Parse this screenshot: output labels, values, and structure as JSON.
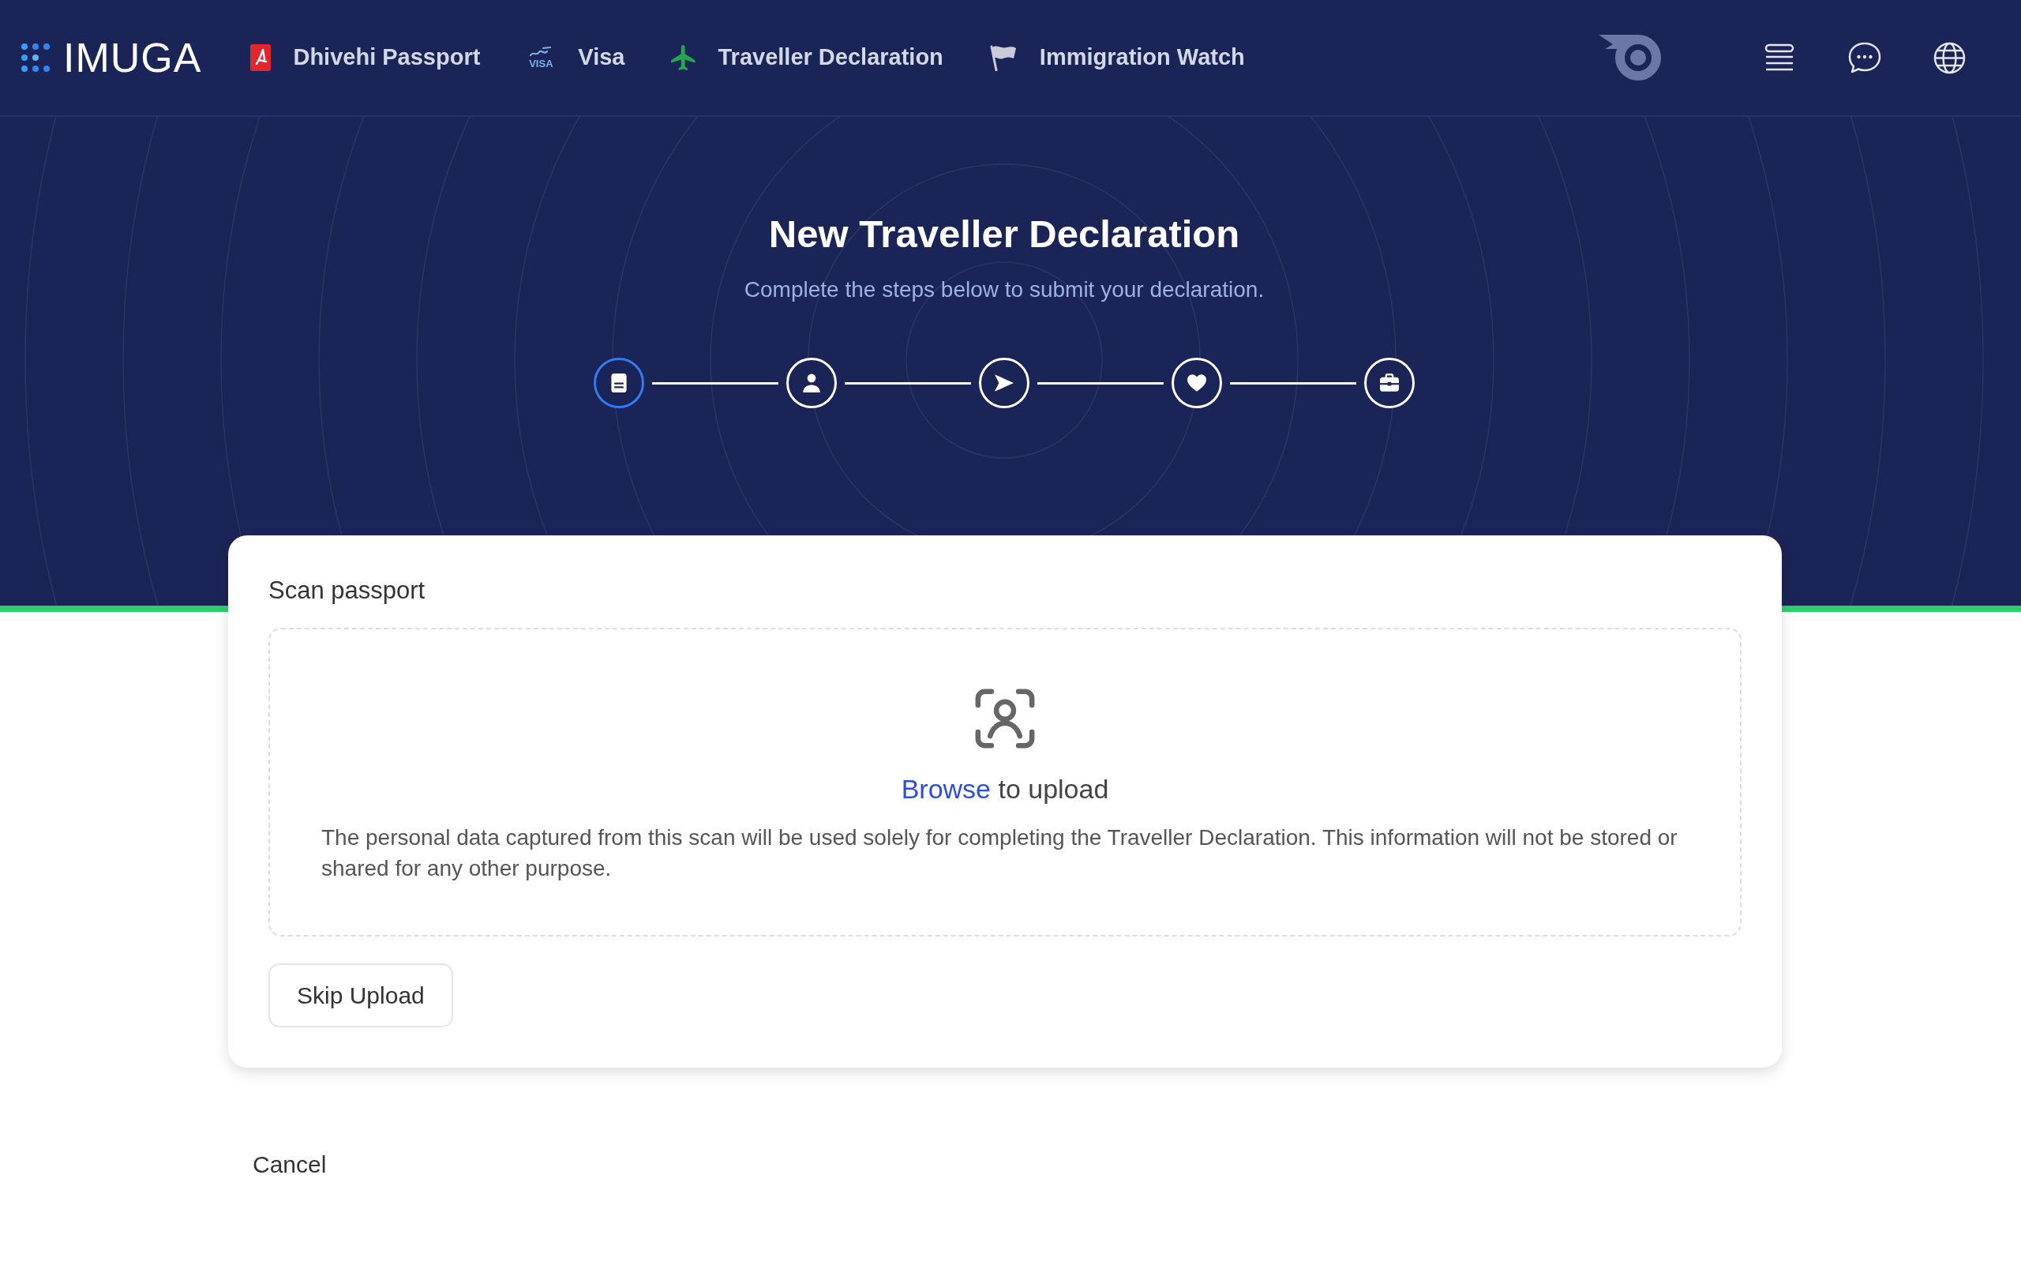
{
  "nav": {
    "brand": "IMUGA",
    "links": [
      {
        "label": "Dhivehi Passport",
        "kind": "passport"
      },
      {
        "label": "Visa",
        "kind": "visa",
        "icon_text": "VISA"
      },
      {
        "label": "Traveller Declaration",
        "kind": "plane"
      },
      {
        "label": "Immigration Watch",
        "kind": "flag"
      }
    ]
  },
  "hero": {
    "title": "New Traveller Declaration",
    "subtitle": "Complete the steps below to submit your declaration.",
    "steps": [
      {
        "kind": "document",
        "selected": true
      },
      {
        "kind": "person",
        "selected": false
      },
      {
        "kind": "send",
        "selected": false
      },
      {
        "kind": "heart",
        "selected": false
      },
      {
        "kind": "briefcase",
        "selected": false
      }
    ]
  },
  "card": {
    "title": "Scan passport",
    "upload": {
      "link": "Browse",
      "text": "to upload"
    },
    "notice": "The personal data captured from this scan will be used solely for completing the Traveller Declaration. This information will not be stored or shared for any other purpose.",
    "button": "Skip Upload"
  },
  "cancel": "Cancel"
}
